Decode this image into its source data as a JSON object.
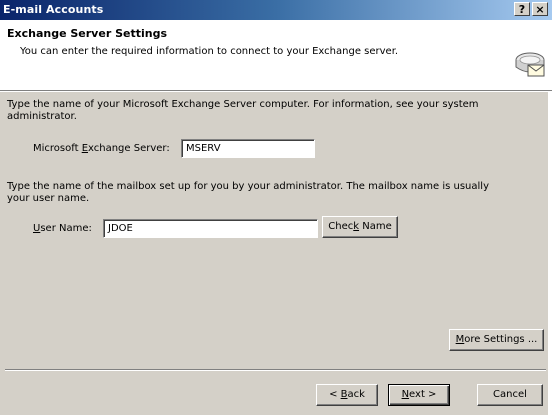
{
  "window": {
    "title": "E-mail Accounts",
    "help_label": "?",
    "close_label": "×"
  },
  "header": {
    "title": "Exchange Server Settings",
    "subtitle": "You can enter the required information to connect to your Exchange server."
  },
  "server_section": {
    "instructions_line1": "Type the name of your Microsoft Exchange Server computer. For information, see your system",
    "instructions_line2": "administrator.",
    "label_pre": "Microsoft ",
    "label_key": "E",
    "label_post": "xchange Server:",
    "value": "MSERV"
  },
  "user_section": {
    "instructions_line1": "Type the name of the mailbox set up for you by your administrator. The mailbox name is usually",
    "instructions_line2": "your user name.",
    "label_key": "U",
    "label_post": "ser Name:",
    "value": "JDOE",
    "check_pre": "Chec",
    "check_key": "k",
    "check_post": " Name"
  },
  "buttons": {
    "more_key": "M",
    "more_post": "ore Settings ...",
    "back_pre": "< ",
    "back_key": "B",
    "back_post": "ack",
    "next_key": "N",
    "next_post": "ext >",
    "cancel": "Cancel"
  },
  "icons": {
    "header": "mail-server-icon"
  }
}
